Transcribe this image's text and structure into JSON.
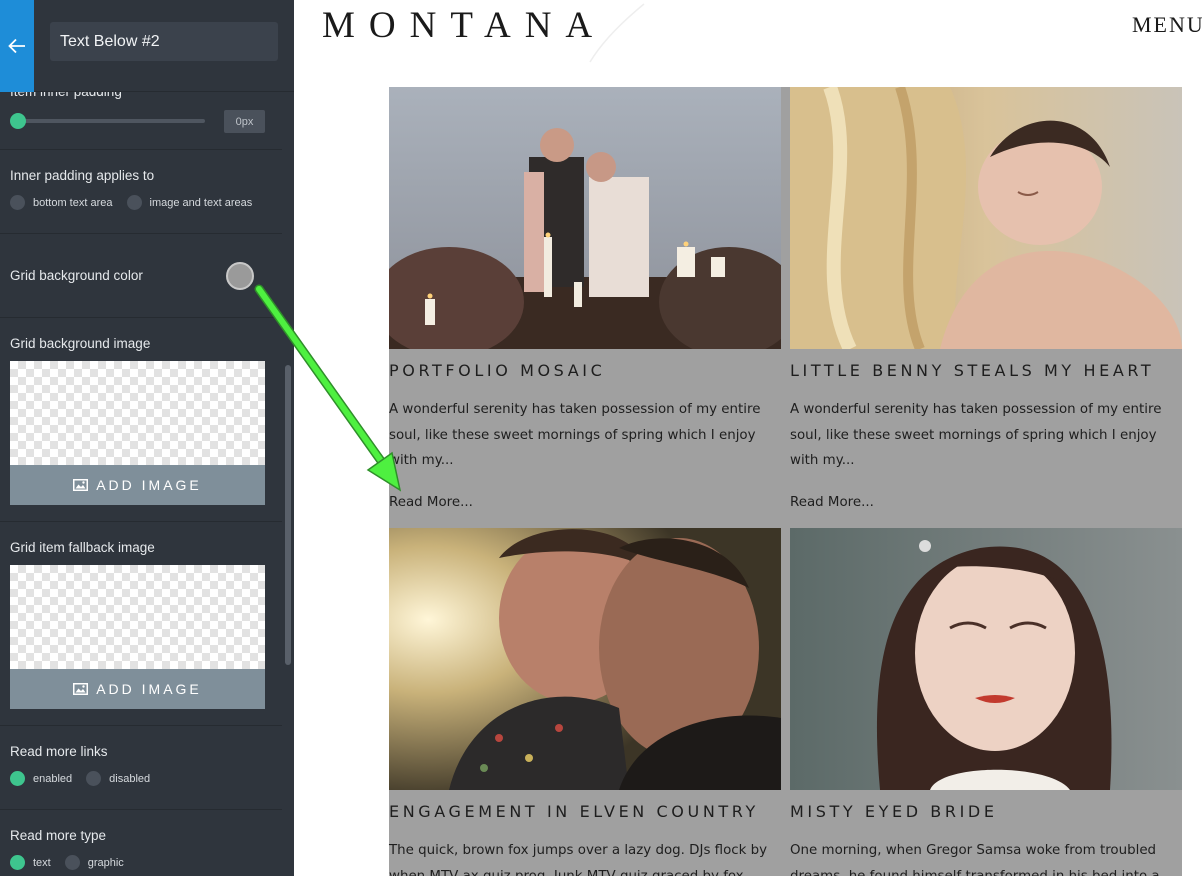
{
  "sidebar": {
    "title_value": "Text Below #2",
    "item_inner_padding": {
      "label": "Item inner padding",
      "value_text": "0px",
      "value": 0
    },
    "inner_padding_applies": {
      "label": "Inner padding applies to",
      "options": [
        "bottom text area",
        "image and text areas"
      ],
      "selected": null
    },
    "grid_bg_color": {
      "label": "Grid background color",
      "color": "#9a9a9a"
    },
    "grid_bg_image": {
      "label": "Grid background image",
      "button": "ADD IMAGE"
    },
    "fallback_image": {
      "label": "Grid item fallback image",
      "button": "ADD IMAGE"
    },
    "read_more_links": {
      "label": "Read more links",
      "options": [
        "enabled",
        "disabled"
      ],
      "selected": "enabled"
    },
    "read_more_type": {
      "label": "Read more type",
      "options": [
        "text",
        "graphic"
      ],
      "selected": "text"
    }
  },
  "site": {
    "logo": "MONTANA",
    "menu": "MENU",
    "grid_bg": "#a0a0a0",
    "cards": [
      {
        "title": "PORTFOLIO MOSAIC",
        "excerpt": "A wonderful serenity has taken possession of my entire soul, like these sweet mornings of spring which I enjoy with my...",
        "read_more": "Read More..."
      },
      {
        "title": "LITTLE BENNY STEALS MY HEART",
        "excerpt": "A wonderful serenity has taken possession of my entire soul, like these sweet mornings of spring which I enjoy with my...",
        "read_more": "Read More..."
      },
      {
        "title": "ENGAGEMENT IN ELVEN COUNTRY",
        "excerpt": "The quick, brown fox jumps over a lazy dog. DJs flock by when MTV ax quiz prog. Junk MTV quiz graced by fox",
        "read_more": ""
      },
      {
        "title": "MISTY EYED BRIDE",
        "excerpt": "One morning, when Gregor Samsa woke from troubled dreams, he found himself transformed in his bed into a",
        "read_more": ""
      }
    ]
  },
  "colors": {
    "accent_blue": "#1e8dd8",
    "toggle_green": "#3ec58e",
    "arrow_green": "#4ef040",
    "sidebar_bg": "#2f353d"
  }
}
